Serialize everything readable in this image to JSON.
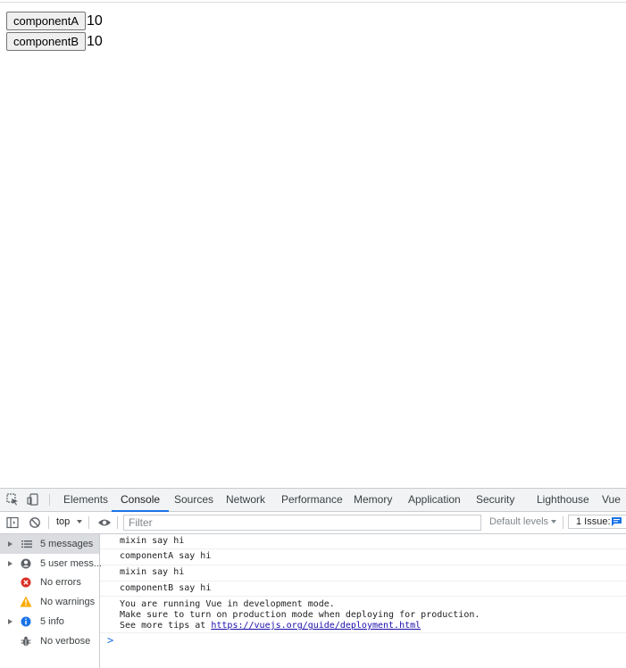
{
  "page": {
    "buttons": [
      {
        "label": "componentA",
        "count": "10"
      },
      {
        "label": "componentB",
        "count": "10"
      }
    ]
  },
  "devtools": {
    "tabs": [
      "Elements",
      "Console",
      "Sources",
      "Network",
      "Performance",
      "Memory",
      "Application",
      "Security",
      "Lighthouse",
      "Vue"
    ],
    "active_tab": "Console",
    "toolbar": {
      "context": "top",
      "filter_placeholder": "Filter",
      "levels": "Default levels",
      "issues": "1 Issue:"
    },
    "sidebar": [
      {
        "label": "5 messages",
        "icon": "list-icon"
      },
      {
        "label": "5 user mess...",
        "icon": "user-icon"
      },
      {
        "label": "No errors",
        "icon": "error-icon"
      },
      {
        "label": "No warnings",
        "icon": "warning-icon"
      },
      {
        "label": "5 info",
        "icon": "info-icon"
      },
      {
        "label": "No verbose",
        "icon": "bug-icon"
      }
    ],
    "messages": [
      {
        "text": "mixin say hi"
      },
      {
        "text": "componentA say hi"
      },
      {
        "text": "mixin say hi"
      },
      {
        "text": "componentB say hi"
      },
      {
        "line1": "You are running Vue in development mode.",
        "line2": "Make sure to turn on production mode when deploying for production.",
        "line3_prefix": "See more tips at ",
        "link": "https://vuejs.org/guide/deployment.html"
      }
    ],
    "prompt": ">"
  },
  "colors": {
    "accent": "#1a73e8",
    "error": "#d93025",
    "warning": "#f9ab00",
    "info": "#1a73e8"
  }
}
